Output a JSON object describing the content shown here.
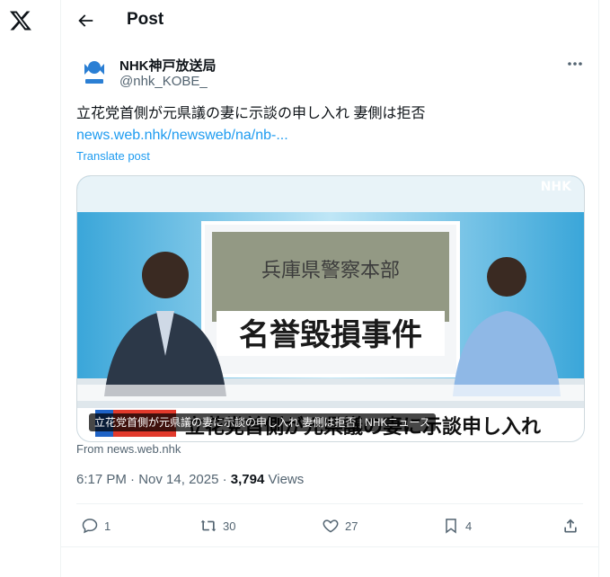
{
  "header": {
    "title": "Post"
  },
  "post": {
    "author_name": "NHK神戸放送局",
    "author_handle": "@nhk_KOBE_",
    "text": "立花党首側が元県議の妻に示談の申し入れ 妻側は拒否",
    "link": "news.web.nhk/newsweb/na/nb-...",
    "translate_label": "Translate post",
    "media": {
      "caption": "立花党首側が元県議の妻に示談の申し入れ 妻側は拒否 | NHKニュース",
      "studio_screen_text": "名誉毀損事件",
      "sign_text": "兵庫県警察本部",
      "lower_third_text": "立花党首側が元県議の妻に示談申し入れ",
      "watermark": "NHK"
    },
    "source": "From news.web.nhk",
    "time": "6:17 PM",
    "date": "Nov 14, 2025",
    "views_count": "3,794",
    "views_label": "Views"
  },
  "actions": {
    "replies": "1",
    "reposts": "30",
    "likes": "27",
    "bookmarks": "4"
  },
  "colors": {
    "link": "#1d9bf0",
    "secondary": "#536471",
    "text": "#0f1419"
  }
}
